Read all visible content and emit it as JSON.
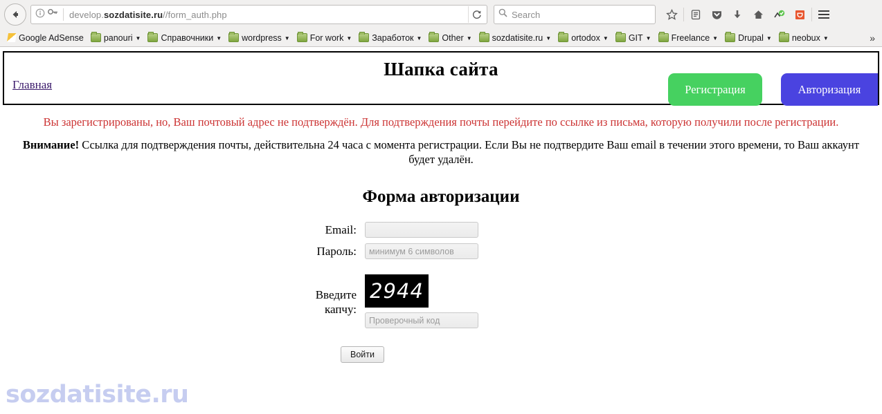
{
  "browser": {
    "back_icon": "back-arrow-icon",
    "identity_icon": "info-circle-icon",
    "key_icon": "key-icon",
    "url_prefix": "develop.",
    "url_host": "sozdatisite.ru",
    "url_path": "//form_auth.php",
    "reload_icon": "reload-icon",
    "search_icon": "search-icon",
    "search_placeholder": "Search",
    "toolbar_icons": [
      {
        "name": "bookmark-star-icon",
        "glyph": "☆"
      },
      {
        "name": "reader-view-icon",
        "glyph": "▤"
      },
      {
        "name": "pocket-shield-icon",
        "glyph": "▼"
      },
      {
        "name": "downloads-icon",
        "glyph": "↓"
      },
      {
        "name": "home-icon",
        "glyph": "⌂"
      },
      {
        "name": "addon-check-icon",
        "glyph": "✓"
      },
      {
        "name": "addon-orange-icon",
        "glyph": "⬛"
      },
      {
        "name": "menu-hamburger-icon",
        "glyph": "☰"
      }
    ],
    "bookmarks": [
      {
        "label": "Google AdSense",
        "icon": "adsense-icon",
        "has_caret": false
      },
      {
        "label": "panouri",
        "icon": "folder-icon",
        "has_caret": true
      },
      {
        "label": "Справочники",
        "icon": "folder-icon",
        "has_caret": true
      },
      {
        "label": "wordpress",
        "icon": "folder-icon",
        "has_caret": true
      },
      {
        "label": "For work",
        "icon": "folder-icon",
        "has_caret": true
      },
      {
        "label": "Заработок",
        "icon": "folder-icon",
        "has_caret": true
      },
      {
        "label": "Other",
        "icon": "folder-icon",
        "has_caret": true
      },
      {
        "label": "sozdatisite.ru",
        "icon": "folder-icon",
        "has_caret": true
      },
      {
        "label": "ortodox",
        "icon": "folder-icon",
        "has_caret": true
      },
      {
        "label": "GIT",
        "icon": "folder-icon",
        "has_caret": true
      },
      {
        "label": "Freelance",
        "icon": "folder-icon",
        "has_caret": true
      },
      {
        "label": "Drupal",
        "icon": "folder-icon",
        "has_caret": true
      },
      {
        "label": "neobux",
        "icon": "folder-icon",
        "has_caret": true
      }
    ],
    "overflow_chevron": "»"
  },
  "site": {
    "header_title": "Шапка сайта",
    "home_link": "Главная",
    "register_button": "Регистрация",
    "auth_button": "Авторизация",
    "register_color": "#46d160",
    "auth_color": "#4a43e0"
  },
  "messages": {
    "alert_color": "#cc3333",
    "alert_text": "Вы зарегистрированы, но, Ваш почтовый адрес не подтверждён. Для подтверждения почты перейдите по ссылке из письма, которую получили после регистрации.",
    "notice_bold": "Внимание!",
    "notice_text": " Ссылка для подтверждения почты, действительна 24 часа с момента регистрации. Если Вы не подтвердите Ваш email в течении этого времени, то Ваш аккаунт будет удалён."
  },
  "form": {
    "title": "Форма авторизации",
    "email_label": "Email:",
    "email_value": "",
    "email_placeholder": "",
    "password_label": "Пароль:",
    "password_placeholder": "минимум 6 символов",
    "captcha_label_line1": "Введите",
    "captcha_label_line2": "капчу:",
    "captcha_code": "2944",
    "captcha_placeholder": "Проверочный код",
    "submit_label": "Войти"
  },
  "watermark": {
    "text": "sozdatisite.ru",
    "color": "#c6cdf0"
  }
}
